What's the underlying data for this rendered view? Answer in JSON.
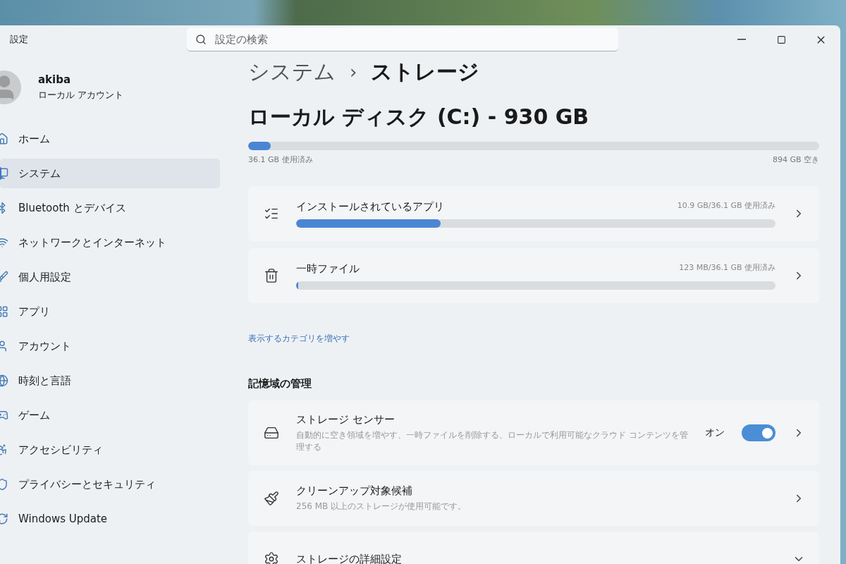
{
  "window": {
    "title": "設定"
  },
  "search": {
    "placeholder": "設定の検索"
  },
  "user": {
    "name": "akiba",
    "account_type": "ローカル アカウント"
  },
  "sidebar": {
    "items": [
      {
        "label": "ホーム",
        "selected": false
      },
      {
        "label": "システム",
        "selected": true
      },
      {
        "label": "Bluetooth とデバイス",
        "selected": false
      },
      {
        "label": "ネットワークとインターネット",
        "selected": false
      },
      {
        "label": "個人用設定",
        "selected": false
      },
      {
        "label": "アプリ",
        "selected": false
      },
      {
        "label": "アカウント",
        "selected": false
      },
      {
        "label": "時刻と言語",
        "selected": false
      },
      {
        "label": "ゲーム",
        "selected": false
      },
      {
        "label": "アクセシビリティ",
        "selected": false
      },
      {
        "label": "プライバシーとセキュリティ",
        "selected": false
      },
      {
        "label": "Windows Update",
        "selected": false
      }
    ]
  },
  "breadcrumb": {
    "parent": "システム",
    "separator": "›",
    "current": "ストレージ"
  },
  "disk": {
    "title": "ローカル ディスク (C:) - 930 GB",
    "level": 0.039,
    "used": "36.1 GB 使用済み",
    "free": "894 GB 空き"
  },
  "usage_categories": [
    {
      "label": "インストールされているアプリ",
      "usage": "10.9 GB/36.1 GB 使用済み",
      "level": 0.302
    },
    {
      "label": "一時ファイル",
      "usage": "123 MB/36.1 GB 使用済み",
      "level": 0.004
    }
  ],
  "more_categories_link": "表示するカテゴリを増やす",
  "storage_management": {
    "heading": "記憶域の管理",
    "items": [
      {
        "kind": "toggle",
        "title": "ストレージ センサー",
        "description": "自動的に空き領域を増やす、一時ファイルを削除する、ローカルで利用可能なクラウド コンテンツを管理する",
        "state_label": "オン",
        "on": true
      },
      {
        "kind": "link",
        "title": "クリーンアップ対象候補",
        "description": "256 MB 以上のストレージが使用可能です。"
      },
      {
        "kind": "expand",
        "title": "ストレージの詳細設定"
      }
    ]
  }
}
